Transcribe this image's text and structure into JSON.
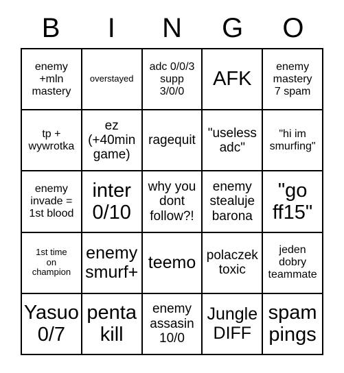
{
  "card": {
    "title": "BINGO",
    "header_letters": [
      "B",
      "I",
      "N",
      "G",
      "O"
    ],
    "background_color": "#ffffff",
    "border_color": "#000000",
    "text_color": "#000000",
    "rows": 5,
    "columns": 5,
    "cells": [
      {
        "text": "enemy\n+mln\nmastery",
        "size": "sm"
      },
      {
        "text": "overstayed",
        "size": "xs"
      },
      {
        "text": "adc 0/0/3\nsupp\n3/0/0",
        "size": "sm"
      },
      {
        "text": "AFK",
        "size": "xl"
      },
      {
        "text": "enemy\nmastery\n7 spam",
        "size": "sm"
      },
      {
        "text": "tp +\nwywrotka",
        "size": "sm"
      },
      {
        "text": "ez\n(+40min\ngame)",
        "size": "md"
      },
      {
        "text": "ragequit",
        "size": "md"
      },
      {
        "text": "\"useless\nadc\"",
        "size": "md"
      },
      {
        "text": "\"hi im\nsmurfing\"",
        "size": "sm"
      },
      {
        "text": "enemy\ninvade =\n1st blood",
        "size": "sm"
      },
      {
        "text": "inter\n0/10",
        "size": "xl"
      },
      {
        "text": "why you\ndont\nfollow?!",
        "size": "md"
      },
      {
        "text": "enemy\nstealuje\nbarona",
        "size": "md"
      },
      {
        "text": "\"go\nff15\"",
        "size": "xl"
      },
      {
        "text": "1st time\non\nchampion",
        "size": "xs"
      },
      {
        "text": "enemy\nsmurf+",
        "size": "lg"
      },
      {
        "text": "teemo",
        "size": "lg"
      },
      {
        "text": "polaczek\ntoxic",
        "size": "md"
      },
      {
        "text": "jeden\ndobry\nteammate",
        "size": "sm"
      },
      {
        "text": "Yasuo\n0/7",
        "size": "xl"
      },
      {
        "text": "penta\nkill",
        "size": "xl"
      },
      {
        "text": "enemy\nassasin\n10/0",
        "size": "md"
      },
      {
        "text": "Jungle\nDIFF",
        "size": "lg"
      },
      {
        "text": "spam\npings",
        "size": "xl"
      }
    ]
  }
}
